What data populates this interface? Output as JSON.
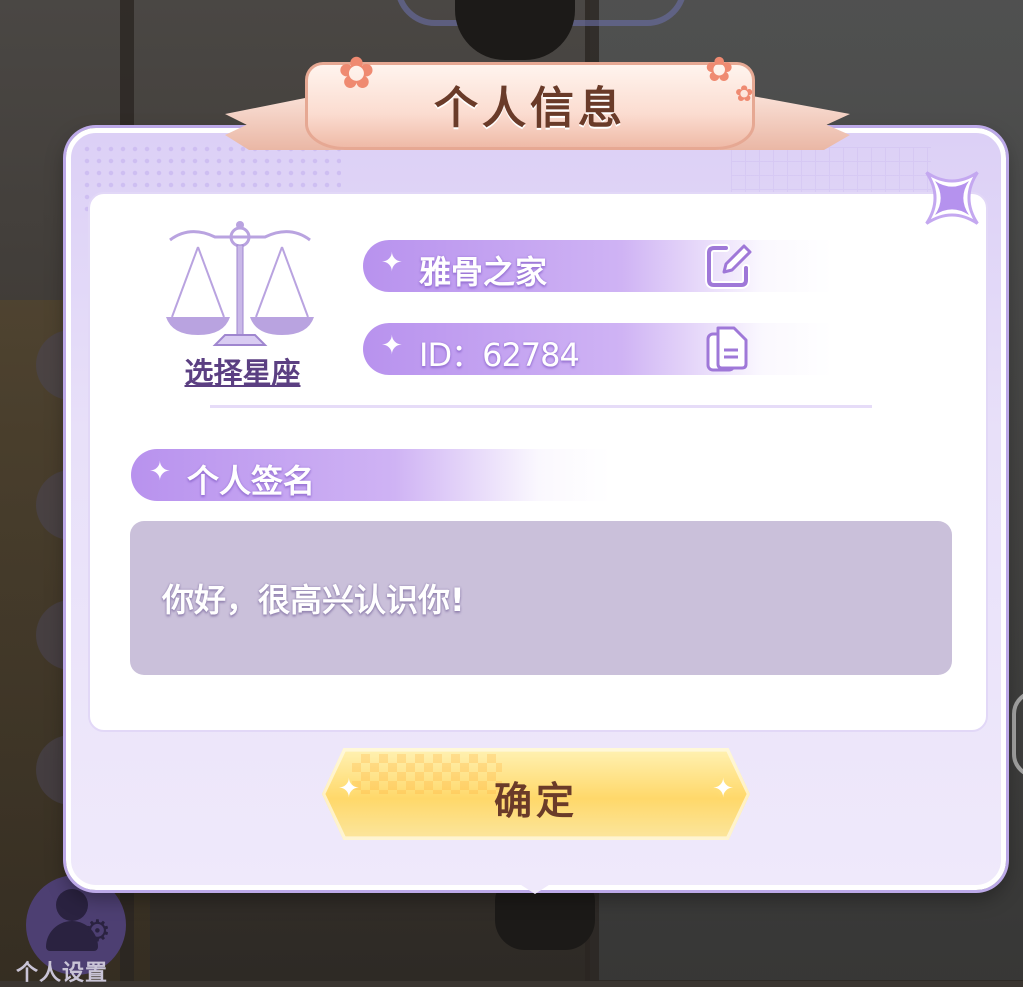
{
  "dialog": {
    "title": "个人信息",
    "zodiac_label": "选择星座",
    "name": "雅骨之家",
    "id_text": "ID：62784",
    "signature_header": "个人签名",
    "signature": "你好，很高兴认识你!",
    "confirm_label": "确定"
  },
  "background": {
    "settings_label": "个人设置"
  },
  "icons": {
    "close": "close-icon",
    "edit": "edit-icon",
    "copy": "copy-icon",
    "zodiac": "libra-scale-icon",
    "sparkle": "sparkle-icon",
    "flower": "flower-icon"
  },
  "colors": {
    "accent": "#b892ee",
    "title_text": "#6a3b29",
    "button_gold": "#ffd86a",
    "signature_bg": "#cac0da"
  }
}
